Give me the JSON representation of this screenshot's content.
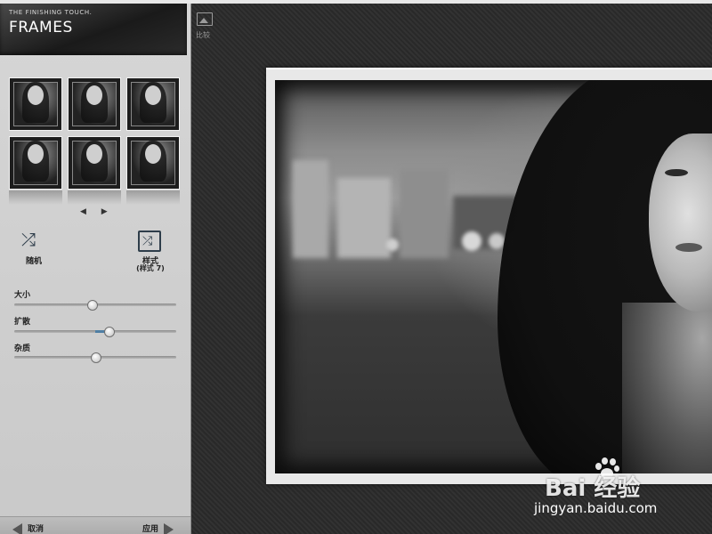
{
  "brand": {
    "subtitle": "THE FINISHING TOUCH.",
    "title": "FRAMES"
  },
  "thumbnails": [
    {
      "label": "frame-1"
    },
    {
      "label": "frame-2"
    },
    {
      "label": "frame-3"
    },
    {
      "label": "frame-4"
    },
    {
      "label": "frame-5"
    },
    {
      "label": "frame-6"
    }
  ],
  "pager": {
    "prev": "◀",
    "next": "▶"
  },
  "controls": {
    "random_label": "随机",
    "style_label": "样式",
    "style_value": "(样式 7)"
  },
  "sliders": [
    {
      "label": "大小",
      "value": 0.48
    },
    {
      "label": "扩散",
      "value": 0.58,
      "fill_start": 0.5
    },
    {
      "label": "杂质",
      "value": 0.5
    }
  ],
  "bottom": {
    "cancel": "取消",
    "apply": "应用"
  },
  "main": {
    "compare_label": "比较"
  },
  "watermark": {
    "logo": "Bai  经验",
    "url": "jingyan.baidu.com"
  },
  "colors": {
    "accent": "#4f7fa4",
    "sidebar": "#d0d0d0",
    "canvas": "#2b2b2b"
  }
}
